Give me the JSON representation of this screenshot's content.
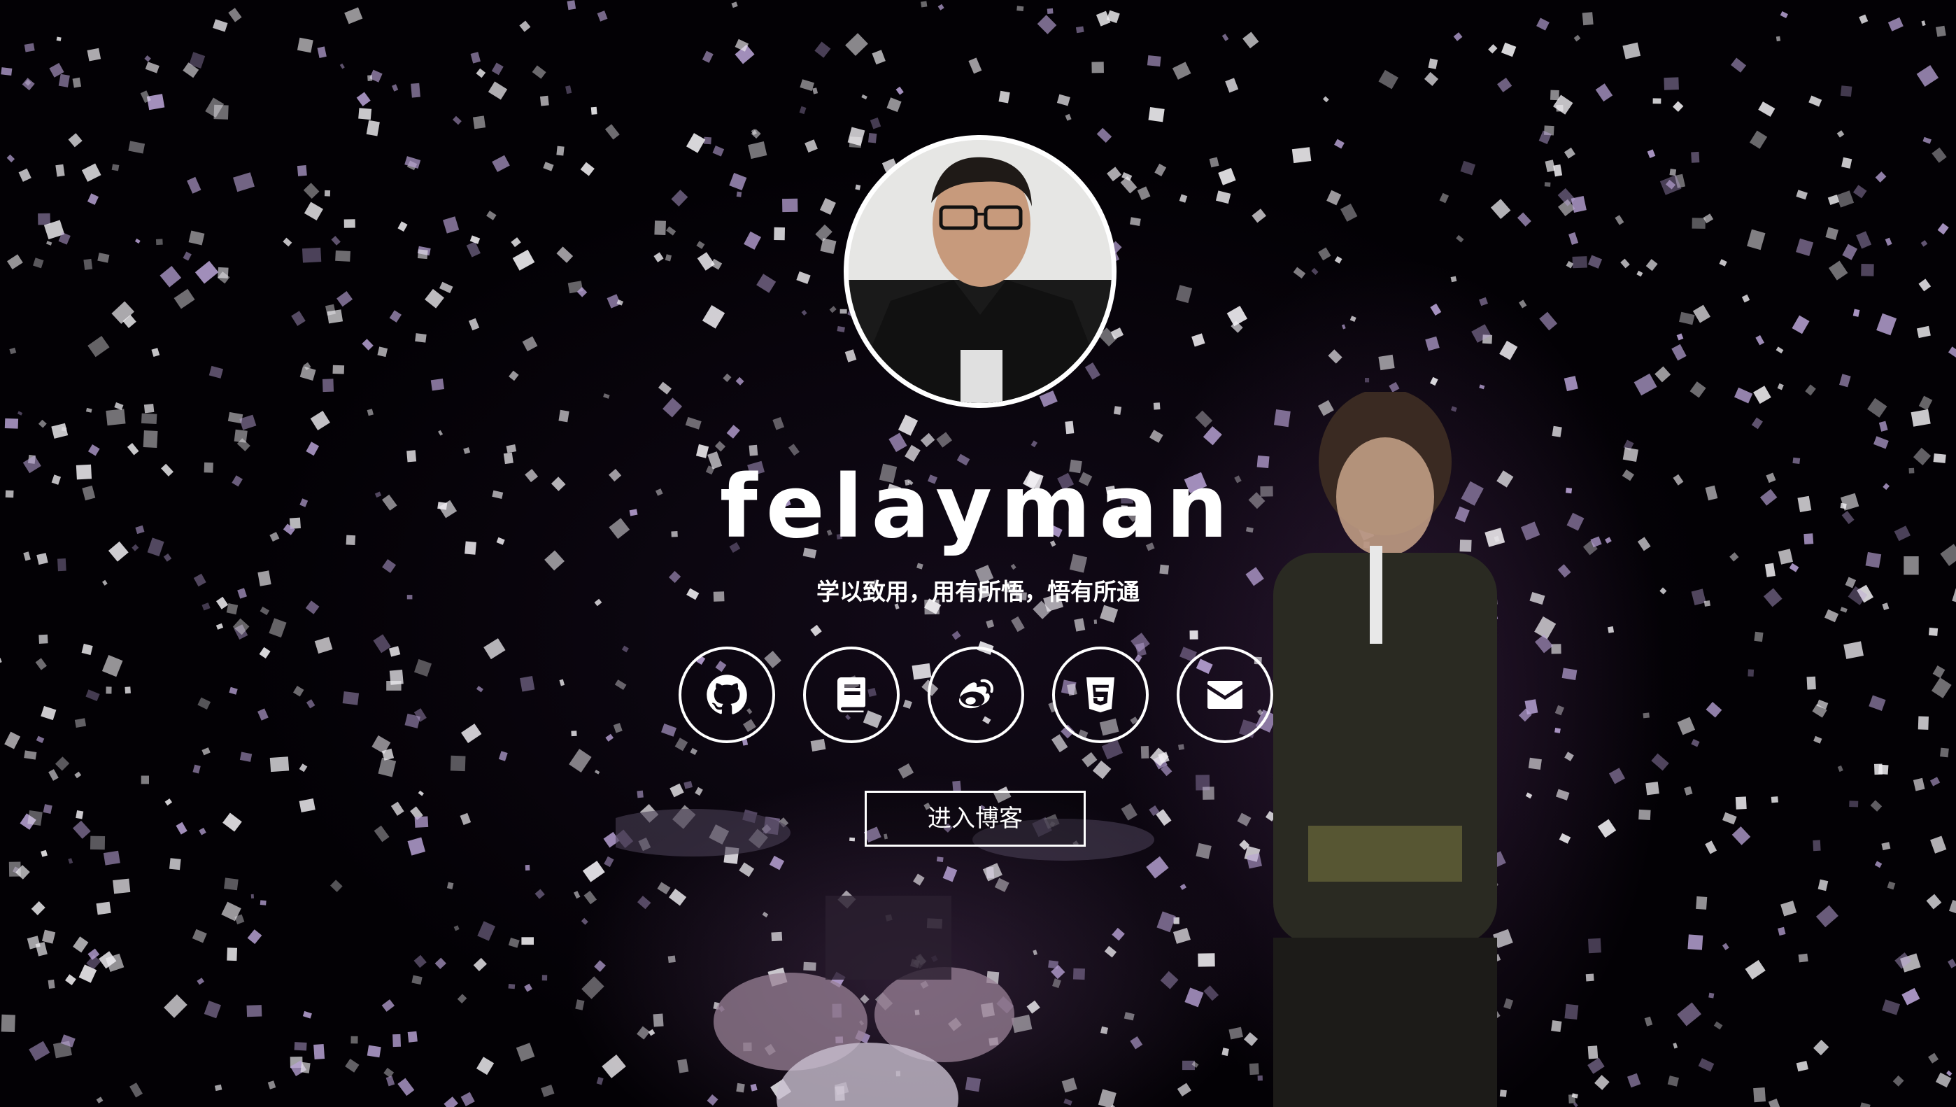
{
  "profile": {
    "name": "felayman",
    "motto": "学以致用，用有所悟，悟有所通"
  },
  "social_links": [
    {
      "icon": "github-icon"
    },
    {
      "icon": "book-icon"
    },
    {
      "icon": "weibo-icon"
    },
    {
      "icon": "html5-icon"
    },
    {
      "icon": "envelope-icon"
    }
  ],
  "enter_button": {
    "label": "进入博客"
  },
  "colors": {
    "background": "#000000",
    "foreground": "#ffffff",
    "confetti_white": "#f2f0f4",
    "confetti_purple": "#b9a3d6"
  }
}
